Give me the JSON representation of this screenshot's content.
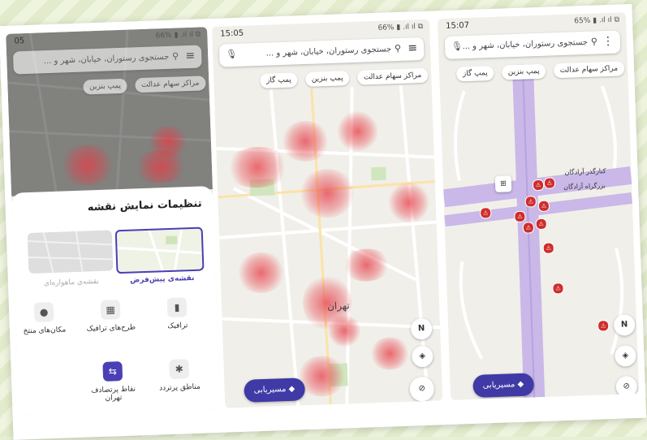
{
  "phone1": {
    "time": "05",
    "status_icons": "66% ▮ .ıl ıl ⧉",
    "search_placeholder": "جستجوی رستوران، خیابان، شهر و ...",
    "chips": [
      "مراکز سهام عدالت",
      "پمپ بنزین"
    ],
    "sheet_title": "تنظیمات نمایش نقشه",
    "map_types": [
      {
        "label": "نقشه‌ی پیش‌فرض",
        "selected": true
      },
      {
        "label": "نقشه‌ی ماهواره‌ای",
        "selected": false
      }
    ],
    "options": [
      {
        "label": "ترافیک",
        "icon": "traffic-light-icon",
        "glyph": "▮"
      },
      {
        "label": "طرح‌های ترافیک",
        "icon": "traffic-plan-icon",
        "glyph": "▦"
      },
      {
        "label": "مکان‌های منتخ",
        "icon": "location-pin-icon",
        "glyph": "●"
      },
      {
        "label": "مناطق پرتردد",
        "icon": "crowd-area-icon",
        "glyph": "✱"
      },
      {
        "label": "نقاط پرتصادف تهران",
        "icon": "car-crash-icon",
        "glyph": "⇆"
      }
    ]
  },
  "phone2": {
    "time": "15:05",
    "status_icons": "66% ▮ .ıl ıl ⧉",
    "search_placeholder": "جستجوی رستوران، خیابان، شهر و ...",
    "chips": [
      "مراکز سهام عدالت",
      "پمپ بنزین",
      "پمپ گاز"
    ],
    "city_label": "تهران",
    "route_button": "مسیریابی",
    "compass": "N"
  },
  "phone3": {
    "time": "15:07",
    "status_icons": "65% ▮ .ıl ıl ⧉",
    "search_placeholder": "جستجوی رستوران، خیابان، شهر و ...",
    "chips": [
      "مراکز سهام عدالت",
      "پمپ بنزین",
      "پمپ گاز"
    ],
    "road_labels": [
      "کنارگذر آزادگان",
      "بزرگراه آزادگان"
    ],
    "route_button": "مسیریابی",
    "compass": "N"
  },
  "colors": {
    "accent": "#3f3aa6",
    "hotspot": "#e63c46",
    "accident": "#cf2d2d",
    "road": "#c9b8e8"
  }
}
